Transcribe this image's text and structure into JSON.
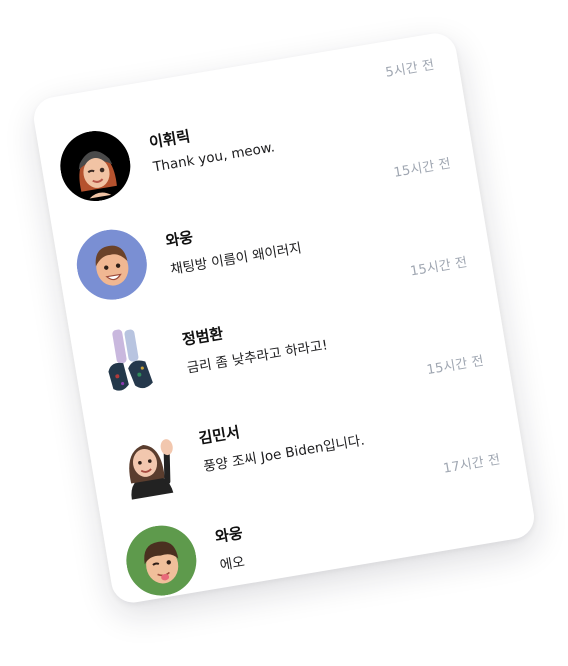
{
  "chats": [
    {
      "name": "이휘릭",
      "message": "Thank you, meow.",
      "time": "5시간 전",
      "avatar_icon": "winking-woman-memoji-icon",
      "avatar_bg": "#000000"
    },
    {
      "name": "와웅",
      "message": "채팅방 이름이 왜이러지",
      "time": "15시간 전",
      "avatar_icon": "smiling-boy-memoji-icon",
      "avatar_bg": "#7a8fd3"
    },
    {
      "name": "정범환",
      "message": "금리 좀 낮추라고 하라고!",
      "time": "15시간 전",
      "avatar_icon": "legs-boots-memoji-icon",
      "avatar_bg": "#ffffff"
    },
    {
      "name": "김민서",
      "message": "풍양 조씨 Joe Biden입니다.",
      "time": "15시간 전",
      "avatar_icon": "waving-woman-memoji-icon",
      "avatar_bg": "#ffffff"
    },
    {
      "name": "와웅",
      "message": "에오",
      "time": "17시간 전",
      "avatar_icon": "tongue-out-boy-memoji-icon",
      "avatar_bg": "#5e9a4c"
    }
  ]
}
